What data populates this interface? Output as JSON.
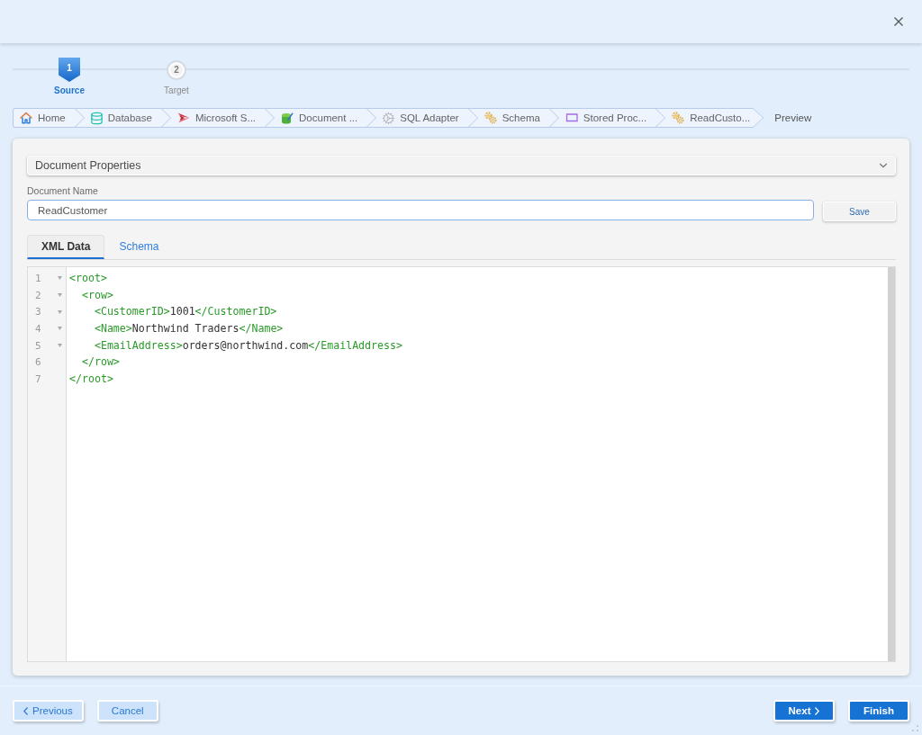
{
  "stepper": {
    "steps": [
      {
        "number": "1",
        "label": "Source",
        "selected": true
      },
      {
        "number": "2",
        "label": "Target",
        "selected": false
      }
    ]
  },
  "breadcrumb": {
    "items": [
      {
        "label": "Home",
        "kind": "home"
      },
      {
        "label": "Database",
        "kind": "database"
      },
      {
        "label": "Microsoft S...",
        "kind": "server"
      },
      {
        "label": "Document ...",
        "kind": "document"
      },
      {
        "label": "SQL Adapter",
        "kind": "adapter"
      },
      {
        "label": "Schema",
        "kind": "schema"
      },
      {
        "label": "Stored Proc...",
        "kind": "procedure"
      },
      {
        "label": "ReadCusto...",
        "kind": "operation"
      }
    ],
    "current": "Preview"
  },
  "properties": {
    "title": "Document Properties",
    "document_name": {
      "label": "Document Name",
      "value": "ReadCustomer"
    },
    "save_button": "Save"
  },
  "tabs": [
    {
      "label": "XML Data",
      "selected": true
    },
    {
      "label": "Schema",
      "selected": false
    }
  ],
  "editor": {
    "lines": [
      {
        "number": "1",
        "text": "<root>",
        "foldable": true
      },
      {
        "number": "2",
        "text": "  <row>",
        "foldable": true
      },
      {
        "number": "3",
        "text": "    <CustomerID>1001</CustomerID>",
        "foldable": true
      },
      {
        "number": "4",
        "text": "    <Name>Northwind Traders</Name>",
        "foldable": true
      },
      {
        "number": "5",
        "text": "    <EmailAddress>orders@northwind.com</EmailAddress>",
        "foldable": true
      },
      {
        "number": "6",
        "text": "  </row>",
        "foldable": false
      },
      {
        "number": "7",
        "text": "</root>",
        "foldable": false
      }
    ]
  },
  "footer": {
    "left_buttons": [
      {
        "label": "Previous",
        "kind": "back"
      },
      {
        "label": "Cancel",
        "kind": "secondary"
      }
    ],
    "right_buttons": [
      {
        "label": "Next",
        "kind": "forward"
      },
      {
        "label": "Finish",
        "kind": "primary"
      }
    ]
  }
}
